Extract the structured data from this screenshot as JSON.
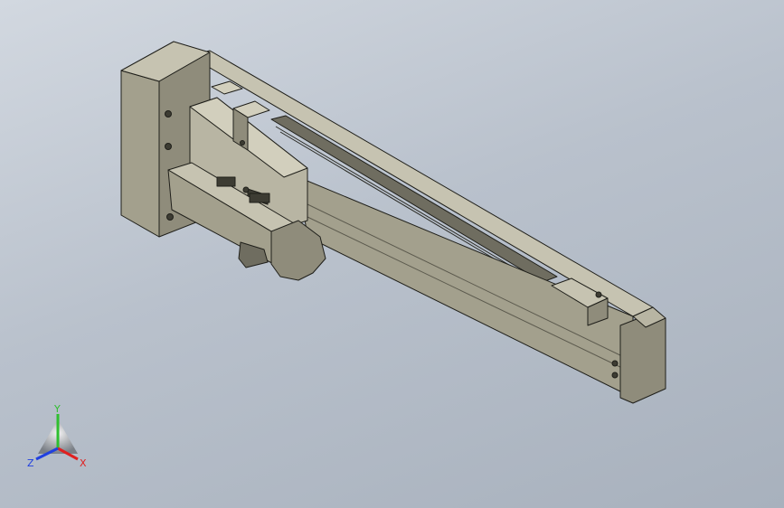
{
  "viewport": {
    "background_top": "#d2d8e0",
    "background_bottom": "#a8b1bd"
  },
  "model": {
    "body_color": "#a3a08d",
    "top_color": "#c6c3b1",
    "side_color": "#8f8c7b",
    "dark_color": "#3d3c33",
    "edge_color": "#1f1f1a"
  },
  "triad": {
    "x_label": "X",
    "y_label": "Y",
    "z_label": "Z",
    "x_color": "#e02020",
    "y_color": "#2fbf2f",
    "z_color": "#2040e0"
  }
}
